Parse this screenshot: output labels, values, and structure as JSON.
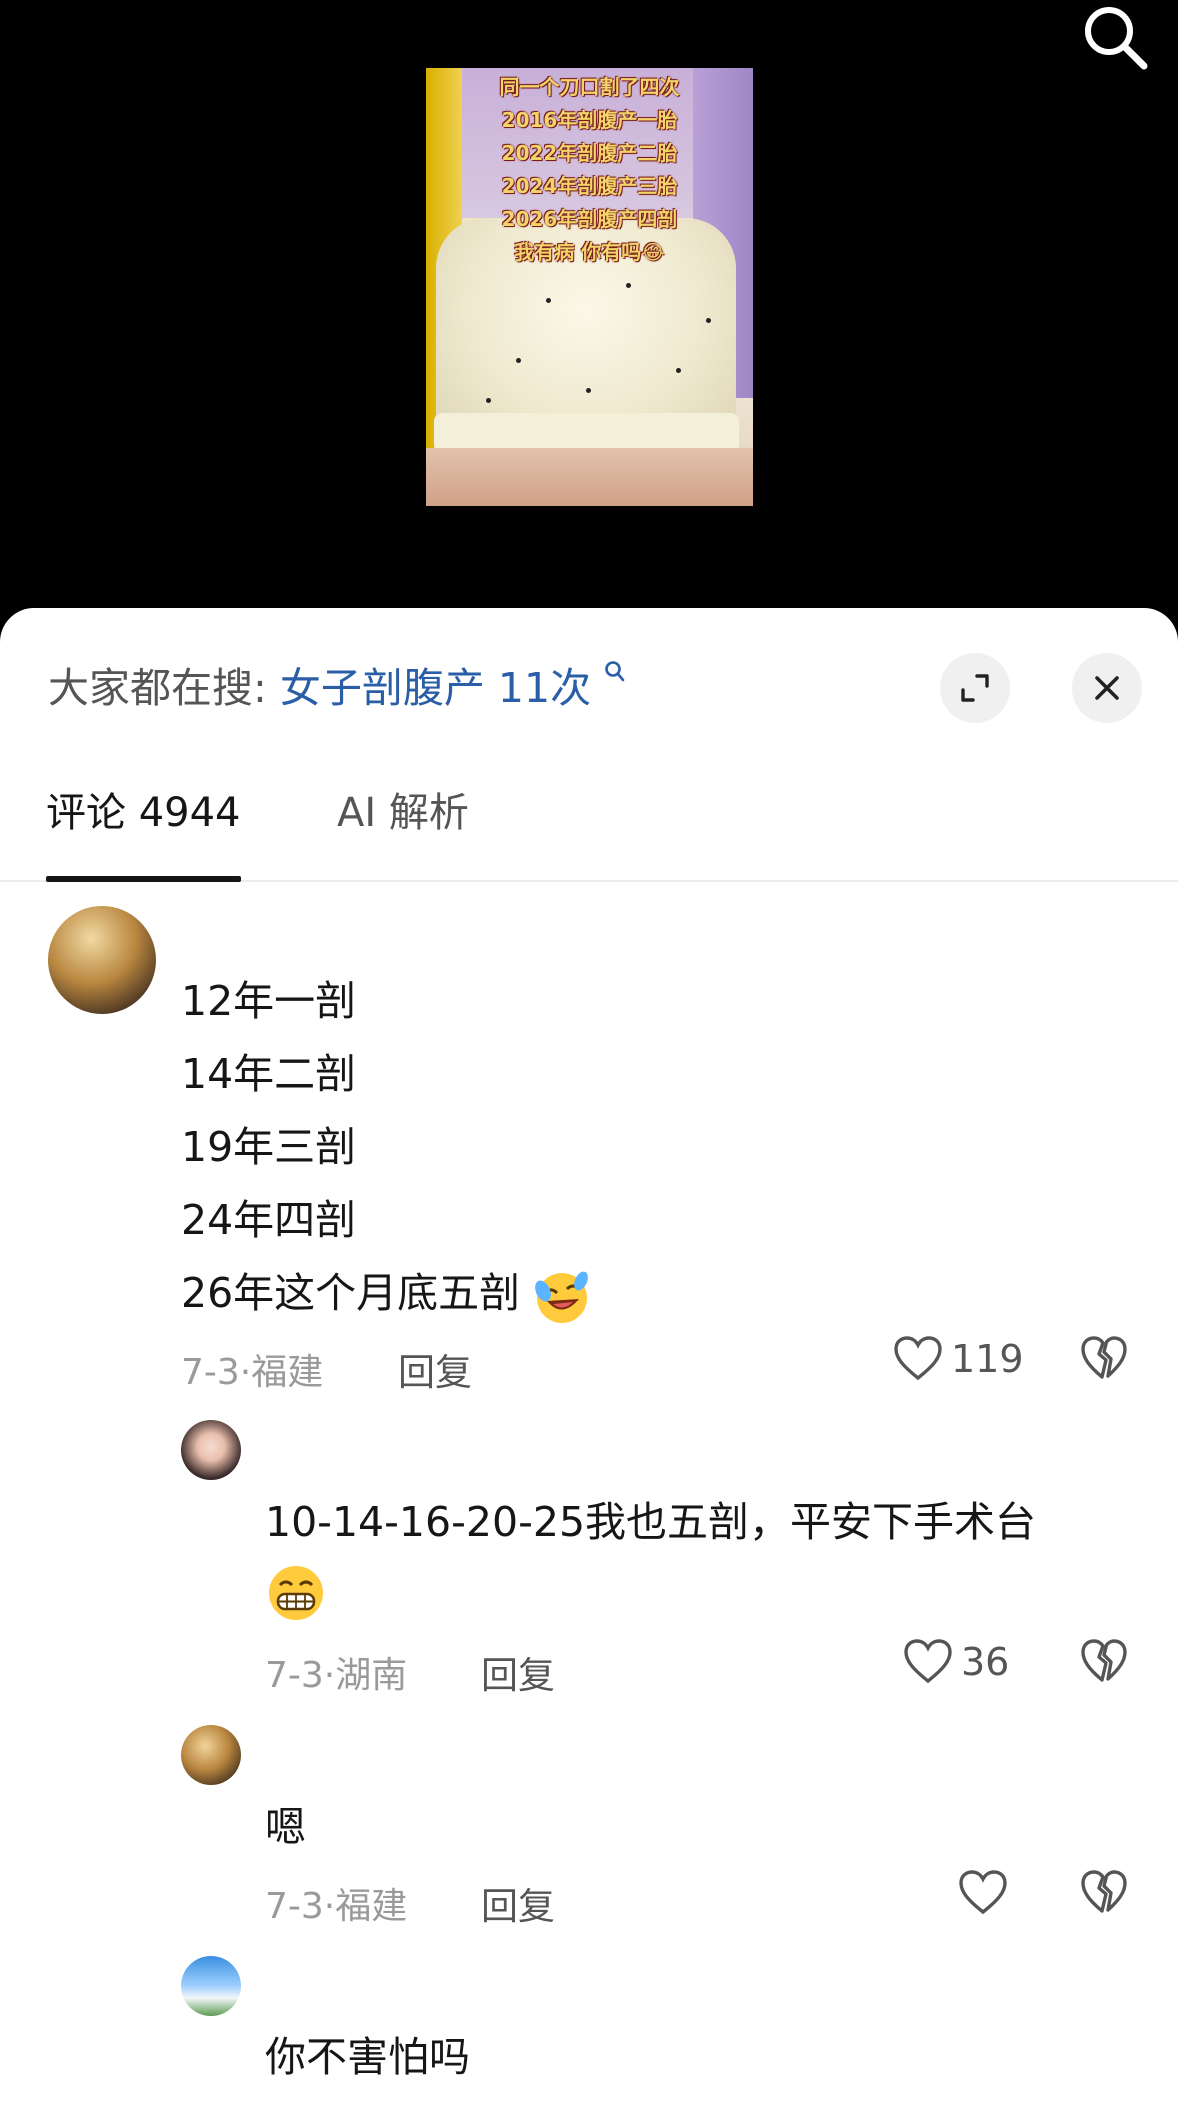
{
  "video": {
    "caption_lines": [
      "同一个刀口割了四次",
      "2016年剖腹产一胎",
      "2022年剖腹产二胎",
      "2024年剖腹产三胎",
      "2026年剖腹产四剖",
      "我有病 你有吗😂"
    ]
  },
  "sheet": {
    "search_prefix": "大家都在搜:",
    "search_term": "女子剖腹产 11次"
  },
  "tabs": {
    "comments": "评论 4944",
    "ai": "AI 解析"
  },
  "comments": [
    {
      "lines": [
        "12年一剖",
        "14年二剖",
        "19年三剖",
        "24年四剖",
        "26年这个月底五剖"
      ],
      "date": "7-3·福建",
      "reply": "回复",
      "likes": "119"
    },
    {
      "lines": [
        "10-14-16-20-25我也五剖，平安下手术台"
      ],
      "date": "7-3·湖南",
      "reply": "回复",
      "likes": "36"
    },
    {
      "lines": [
        "嗯"
      ],
      "date": "7-3·福建",
      "reply": "回复",
      "likes": ""
    },
    {
      "lines": [
        "你不害怕吗"
      ]
    }
  ]
}
